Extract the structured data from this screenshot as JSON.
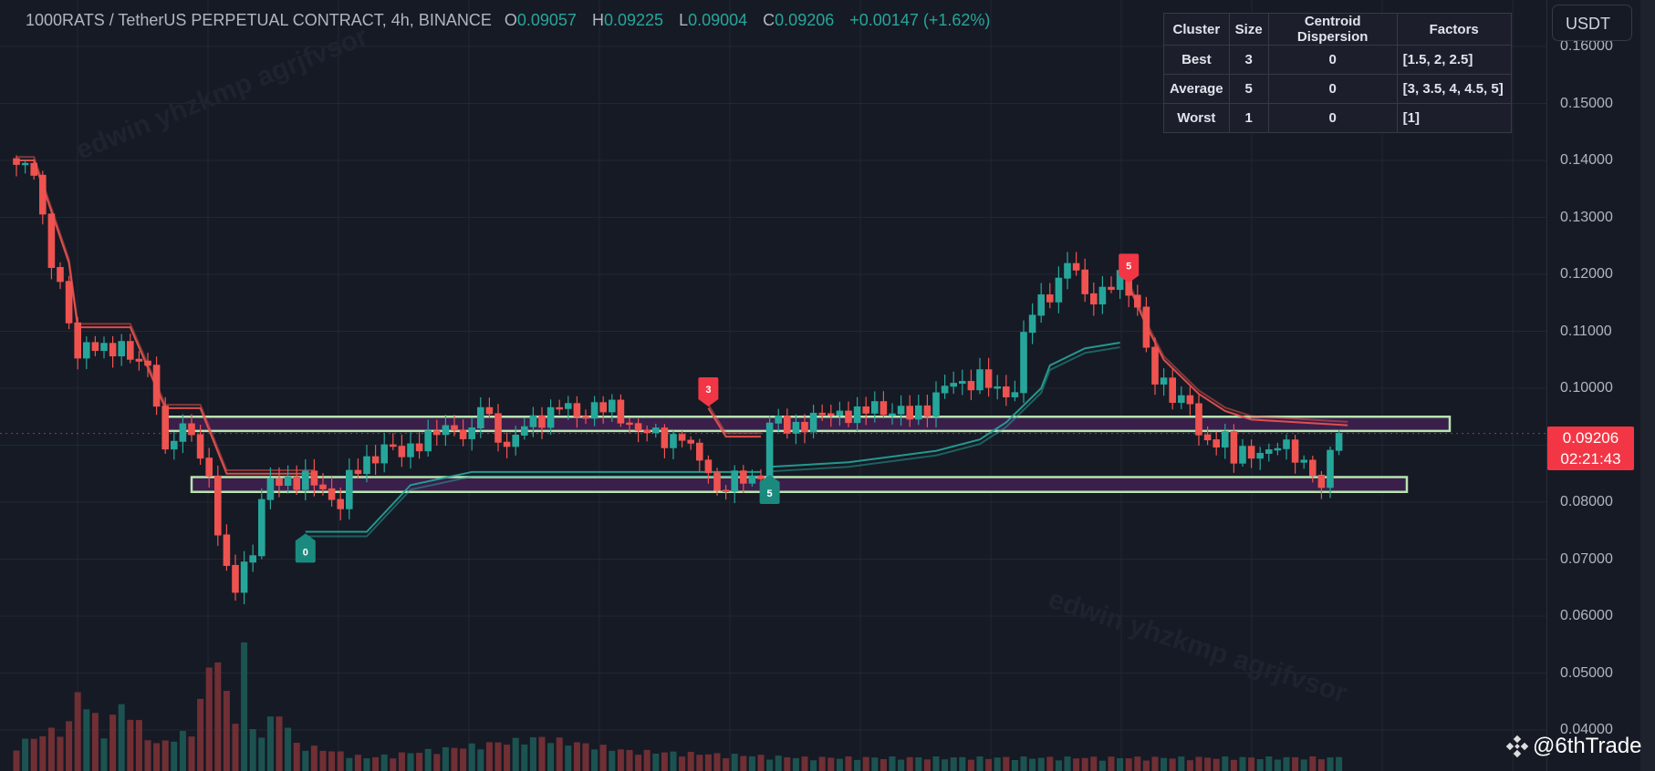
{
  "header": {
    "symbol": "1000RATS / TetherUS PERPETUAL CONTRACT, 4h, BINANCE",
    "o_label": "O",
    "o": "0.09057",
    "h_label": "H",
    "h": "0.09225",
    "l_label": "L",
    "l": "0.09004",
    "c_label": "C",
    "c": "0.09206",
    "change": "+0.00147 (+1.62%)"
  },
  "cluster_table": {
    "headers": [
      "Cluster",
      "Size",
      "Centroid Dispersion",
      "Factors"
    ],
    "rows": [
      [
        "Best",
        "3",
        "0",
        "[1.5, 2, 2.5]"
      ],
      [
        "Average",
        "5",
        "0",
        "[3, 3.5, 4, 4.5, 5]"
      ],
      [
        "Worst",
        "1",
        "0",
        "[1]"
      ]
    ]
  },
  "currency_button": "USDT",
  "price_axis": [
    "0.16000",
    "0.15000",
    "0.14000",
    "0.13000",
    "0.12000",
    "0.11000",
    "0.10000",
    "0.09000",
    "0.08000",
    "0.07000",
    "0.06000",
    "0.05000",
    "0.04000"
  ],
  "last_price": {
    "price": "0.09206",
    "countdown": "02:21:43"
  },
  "watermark": "edwin yhzkmp agrjfvsor",
  "credit": "@6thTrade",
  "colors": {
    "up": "#26a69a",
    "down": "#ef5350",
    "band_fill": "#3a1f4a",
    "band_stroke": "#b7e4b0",
    "bg": "#161a25"
  },
  "chart_data": {
    "type": "candlestick",
    "interval": "4h",
    "price_range": [
      0.035,
      0.165
    ],
    "candle_count": 152,
    "close_keypoints": [
      [
        0,
        0.1385
      ],
      [
        2,
        0.139
      ],
      [
        3,
        0.13
      ],
      [
        4,
        0.122
      ],
      [
        5,
        0.117
      ],
      [
        6,
        0.112
      ],
      [
        7,
        0.106
      ],
      [
        8,
        0.108
      ],
      [
        10,
        0.106
      ],
      [
        12,
        0.108
      ],
      [
        14,
        0.104
      ],
      [
        15,
        0.103
      ],
      [
        16,
        0.098
      ],
      [
        17,
        0.089
      ],
      [
        18,
        0.092
      ],
      [
        20,
        0.092
      ],
      [
        21,
        0.088
      ],
      [
        22,
        0.085
      ],
      [
        23,
        0.075
      ],
      [
        24,
        0.067
      ],
      [
        25,
        0.065
      ],
      [
        26,
        0.069
      ],
      [
        27,
        0.072
      ],
      [
        28,
        0.08
      ],
      [
        29,
        0.083
      ],
      [
        31,
        0.084
      ],
      [
        33,
        0.084
      ],
      [
        35,
        0.082
      ],
      [
        37,
        0.08
      ],
      [
        38,
        0.084
      ],
      [
        40,
        0.087
      ],
      [
        42,
        0.09
      ],
      [
        44,
        0.088
      ],
      [
        46,
        0.091
      ],
      [
        48,
        0.092
      ],
      [
        50,
        0.093
      ],
      [
        52,
        0.092
      ],
      [
        53,
        0.097
      ],
      [
        54,
        0.094
      ],
      [
        56,
        0.09
      ],
      [
        58,
        0.093
      ],
      [
        60,
        0.095
      ],
      [
        62,
        0.097
      ],
      [
        64,
        0.095
      ],
      [
        66,
        0.097
      ],
      [
        68,
        0.096
      ],
      [
        70,
        0.094
      ],
      [
        72,
        0.092
      ],
      [
        74,
        0.091
      ],
      [
        76,
        0.092
      ],
      [
        77,
        0.089
      ],
      [
        78,
        0.087
      ],
      [
        79,
        0.086
      ],
      [
        80,
        0.082
      ],
      [
        81,
        0.083
      ],
      [
        83,
        0.084
      ],
      [
        85,
        0.085
      ],
      [
        86,
        0.094
      ],
      [
        88,
        0.093
      ],
      [
        90,
        0.094
      ],
      [
        92,
        0.095
      ],
      [
        94,
        0.096
      ],
      [
        96,
        0.095
      ],
      [
        98,
        0.097
      ],
      [
        100,
        0.096
      ],
      [
        102,
        0.095
      ],
      [
        104,
        0.097
      ],
      [
        106,
        0.1
      ],
      [
        108,
        0.101
      ],
      [
        110,
        0.102
      ],
      [
        112,
        0.099
      ],
      [
        114,
        0.1
      ],
      [
        115,
        0.109
      ],
      [
        116,
        0.113
      ],
      [
        118,
        0.117
      ],
      [
        119,
        0.119
      ],
      [
        120,
        0.122
      ],
      [
        121,
        0.12
      ],
      [
        122,
        0.116
      ],
      [
        124,
        0.117
      ],
      [
        126,
        0.119
      ],
      [
        127,
        0.117
      ],
      [
        128,
        0.115
      ],
      [
        129,
        0.107
      ],
      [
        130,
        0.101
      ],
      [
        132,
        0.099
      ],
      [
        134,
        0.098
      ],
      [
        135,
        0.091
      ],
      [
        136,
        0.09
      ],
      [
        138,
        0.092
      ],
      [
        139,
        0.088
      ],
      [
        141,
        0.088
      ],
      [
        142,
        0.089
      ],
      [
        144,
        0.09
      ],
      [
        146,
        0.088
      ],
      [
        147,
        0.087
      ],
      [
        148,
        0.086
      ],
      [
        149,
        0.082
      ],
      [
        150,
        0.088
      ],
      [
        151,
        0.09206
      ]
    ],
    "volume_keypoints": [
      [
        0,
        0.2
      ],
      [
        6,
        0.35
      ],
      [
        7,
        0.6
      ],
      [
        10,
        0.3
      ],
      [
        12,
        0.5
      ],
      [
        16,
        0.2
      ],
      [
        20,
        0.3
      ],
      [
        22,
        0.75
      ],
      [
        23,
        0.95
      ],
      [
        24,
        0.55
      ],
      [
        25,
        0.4
      ],
      [
        26,
        0.95
      ],
      [
        27,
        0.3
      ],
      [
        28,
        0.3
      ],
      [
        30,
        0.45
      ],
      [
        32,
        0.2
      ],
      [
        40,
        0.1
      ],
      [
        60,
        0.25
      ],
      [
        65,
        0.2
      ],
      [
        70,
        0.15
      ],
      [
        90,
        0.1
      ],
      [
        110,
        0.1
      ],
      [
        151,
        0.1
      ]
    ],
    "supertrend_bear": [
      [
        [
          0,
          0.14
        ],
        [
          2,
          0.14
        ],
        [
          6,
          0.122
        ],
        [
          7,
          0.1107
        ],
        [
          13,
          0.1107
        ],
        [
          17,
          0.0965
        ],
        [
          21,
          0.0965
        ],
        [
          24,
          0.085
        ],
        [
          34,
          0.085
        ]
      ],
      [
        [
          79,
          0.0965
        ],
        [
          81,
          0.0915
        ],
        [
          85,
          0.0915
        ]
      ],
      [
        [
          127,
          0.118
        ],
        [
          129,
          0.111
        ],
        [
          131,
          0.105
        ],
        [
          135,
          0.099
        ],
        [
          138,
          0.096
        ],
        [
          141,
          0.0945
        ],
        [
          152,
          0.0935
        ]
      ]
    ],
    "supertrend_bull": [
      [
        [
          33,
          0.0748
        ],
        [
          40,
          0.0748
        ],
        [
          45,
          0.083
        ],
        [
          52,
          0.0853
        ],
        [
          85,
          0.0853
        ]
      ],
      [
        [
          86,
          0.0862
        ],
        [
          95,
          0.087
        ],
        [
          100,
          0.088
        ],
        [
          105,
          0.089
        ],
        [
          110,
          0.091
        ],
        [
          113,
          0.094
        ],
        [
          115,
          0.097
        ],
        [
          117,
          0.1
        ],
        [
          118,
          0.104
        ],
        [
          122,
          0.107
        ],
        [
          126,
          0.108
        ]
      ]
    ],
    "zones": [
      [
        0.0925,
        0.095
      ],
      [
        0.0818,
        0.0844
      ]
    ],
    "signals": [
      {
        "index": 33,
        "price": 0.0745,
        "text": "0",
        "dir": "up"
      },
      {
        "index": 79,
        "price": 0.0968,
        "text": "3",
        "dir": "down"
      },
      {
        "index": 86,
        "price": 0.0848,
        "text": "5",
        "dir": "up"
      },
      {
        "index": 127,
        "price": 0.1185,
        "text": "5",
        "dir": "down"
      }
    ]
  }
}
